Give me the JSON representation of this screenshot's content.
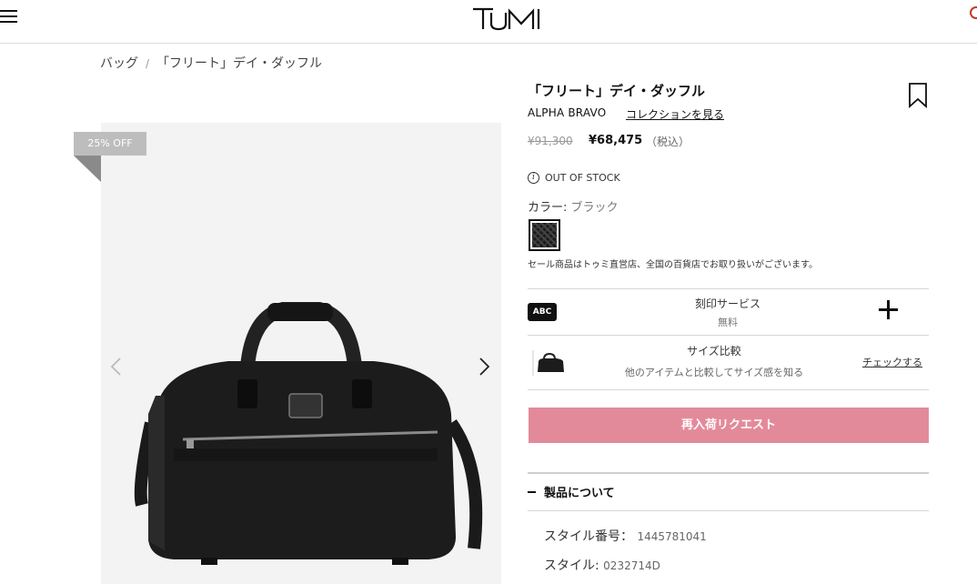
{
  "header": {
    "logo_text": "TUMI",
    "menu_icon": "hamburger-menu-icon"
  },
  "breadcrumb": {
    "items": [
      "バッグ",
      "「フリート」デイ・ダッフル"
    ],
    "separator": "/"
  },
  "gallery": {
    "badge": "25% OFF",
    "prev_icon": "chevron-left-icon",
    "next_icon": "chevron-right-icon"
  },
  "product": {
    "title": "「フリート」デイ・ダッフル",
    "collection": "ALPHA BRAVO",
    "collection_link": "コレクションを見る",
    "price_old": "¥91,300",
    "price_new": "¥68,475",
    "price_tax": "（税込）",
    "stock_status": "OUT OF STOCK",
    "color_label": "カラー:",
    "color_value": "ブラック",
    "sale_note": "セール商品はトゥミ直営店、全国の百貨店でお取り扱いがございます。"
  },
  "engraving": {
    "badge": "ABC",
    "title": "刻印サービス",
    "subtitle": "無料"
  },
  "size_compare": {
    "title": "サイズ比較",
    "subtitle": "他のアイテムと比較してサイズ感を知る",
    "link": "チェックする"
  },
  "restock_button": "再入荷リクエスト",
  "about": {
    "heading": "製品について",
    "style_number_label": "スタイル番号：",
    "style_number_value": "1445781041",
    "style_label": "スタイル:",
    "style_value": "0232714D"
  },
  "colors": {
    "restock_button": "#e38a9a",
    "badge": "#bdbdbd"
  }
}
